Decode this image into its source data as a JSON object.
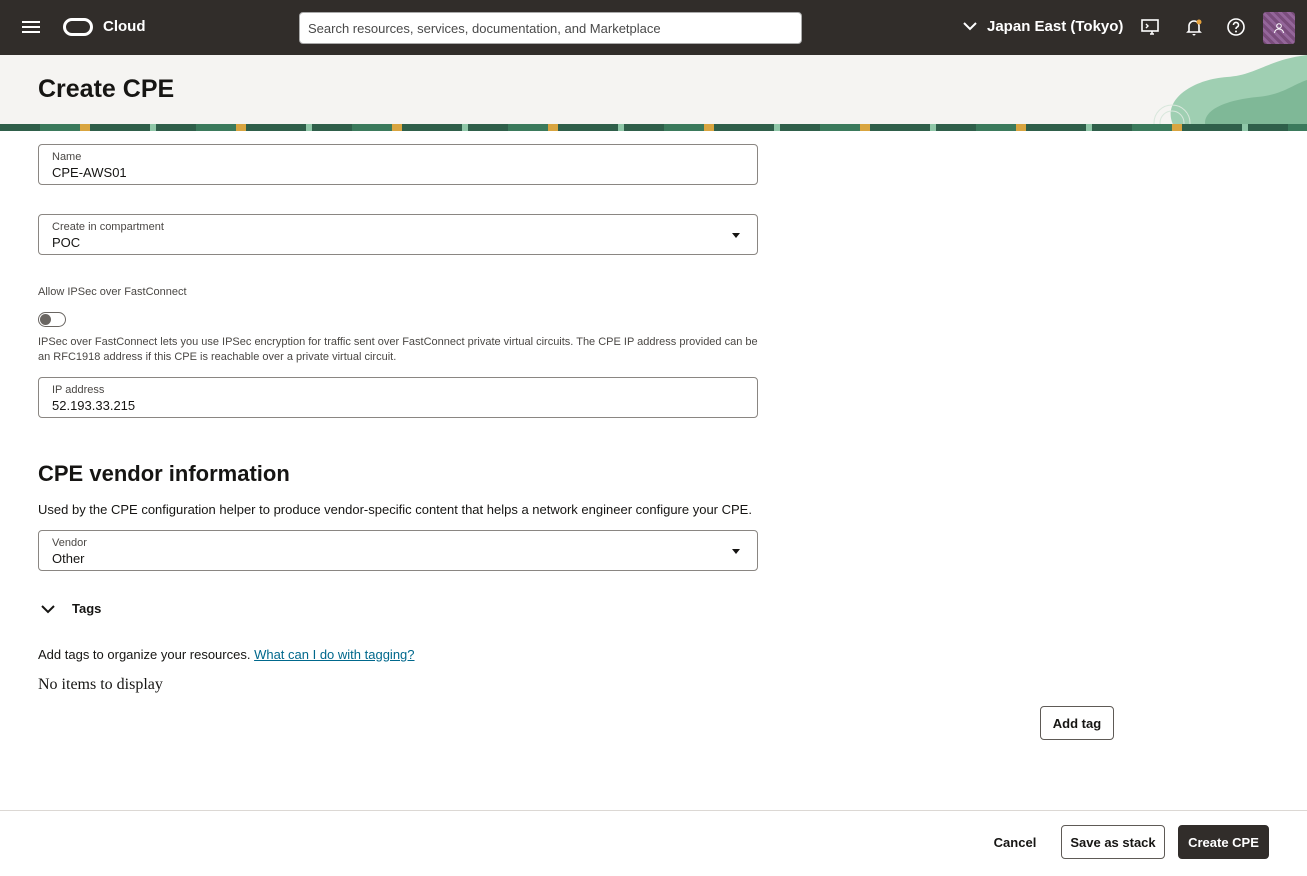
{
  "topbar": {
    "brand": "Cloud",
    "search_placeholder": "Search resources, services, documentation, and Marketplace",
    "region": "Japan East (Tokyo)",
    "icons": [
      "menu-icon",
      "cloud-shell-icon",
      "bell-icon",
      "help-icon",
      "user-icon"
    ]
  },
  "header": {
    "title": "Create CPE"
  },
  "form": {
    "name": {
      "label": "Name",
      "value": "CPE-AWS01"
    },
    "compartment": {
      "label": "Create in compartment",
      "value": "POC"
    },
    "ipsec": {
      "label": "Allow IPSec over FastConnect",
      "enabled": false,
      "help": "IPSec over FastConnect lets you use IPSec encryption for traffic sent over FastConnect private virtual circuits. The CPE IP address provided can be an RFC1918 address if this CPE is reachable over a private virtual circuit."
    },
    "ip_address": {
      "label": "IP address",
      "value": "52.193.33.215"
    }
  },
  "vendor_section": {
    "title": "CPE vendor information",
    "description": "Used by the CPE configuration helper to produce vendor-specific content that helps a network engineer configure your CPE.",
    "vendor": {
      "label": "Vendor",
      "value": "Other"
    }
  },
  "tags": {
    "label": "Tags",
    "description": "Add tags to organize your resources.",
    "link": "What can I do with tagging?",
    "empty": "No items to display",
    "add_button": "Add tag"
  },
  "footer": {
    "cancel": "Cancel",
    "save_stack": "Save as stack",
    "create": "Create CPE"
  }
}
